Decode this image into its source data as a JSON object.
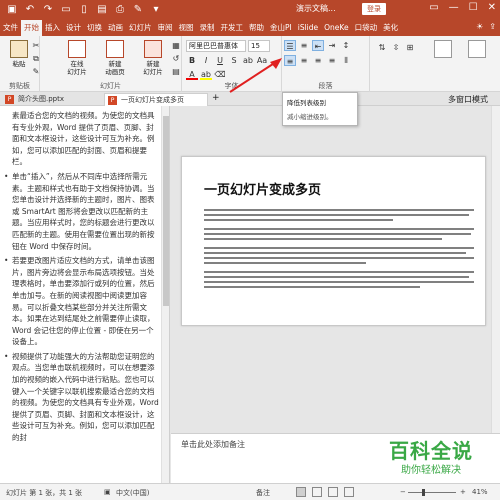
{
  "titlebar": {
    "title": "演示文稿...",
    "login": "登录",
    "bg": "#b7472a"
  },
  "tabs": [
    "文件",
    "开始",
    "插入",
    "设计",
    "切换",
    "动画",
    "幻灯片",
    "审阅",
    "视图",
    "录制",
    "开发工",
    "帮助",
    "金山PI",
    "iSlide",
    "OneKe",
    "口袋动",
    "美化"
  ],
  "tab_active_index": 1,
  "tabs_right": {
    "search_icon": "lightbulb-icon",
    "share_icon": "share-icon"
  },
  "ribbon": {
    "clipboard": {
      "label": "剪贴板",
      "paste": "粘贴"
    },
    "slides_group": {
      "label": "幻灯片",
      "new_slide": "新建\n幻灯片",
      "reuse": "在线\n幻灯片",
      "online": "新建\n动画页"
    },
    "font": {
      "label": "字体",
      "name": "阿里巴巴普惠体",
      "size": "15"
    },
    "paragraph": {
      "label": "段落"
    }
  },
  "tooltip": {
    "title": "降低列表级别",
    "desc": "减小缩进级别。"
  },
  "doctabs": [
    {
      "label": "简介头图.pptx",
      "active": false
    },
    {
      "label": "一页幻灯片变成多页",
      "active": true
    }
  ],
  "doctabs_right": "多窗口模式",
  "outline": [
    {
      "bullet": false,
      "text": "素最适合您的文档的视频。为使您的文档具有专业外观，Word 提供了页眉、页脚、封面和文本框设计，这些设计可互为补充。例如，您可以添加匹配的封面、页眉和提要栏。"
    },
    {
      "bullet": true,
      "text": "单击“插入”，然后从不同库中选择所需元素。主题和样式也有助于文档保持协调。当您单击设计并选择新的主题时，图片、图表或 SmartArt 图形将会更改以匹配新的主题。当应用样式时，您的标题会进行更改以匹配新的主题。使用在需要位置出现的新按钮在 Word 中保存时间。"
    },
    {
      "bullet": true,
      "text": "若要更改图片适应文档的方式，请单击该图片，图片旁边将会显示布局选项按钮。当处理表格时，单击要添加行或列的位置，然后单击加号。在新的阅读视图中阅读更加容易。可以折叠文档某些部分并关注所需文本。如果在达到结尾处之前需要停止读取，Word 会记住您的停止位置 - 即使在另一个设备上。"
    },
    {
      "bullet": true,
      "text": "视频提供了功能强大的方法帮助您证明您的观点。当您单击联机视频时，可以在想要添加的视频的嵌入代码中进行粘贴。您也可以键入一个关键字以联机搜索最适合您的文档的视频。为使您的文档具有专业外观，Word 提供了页眉、页脚、封面和文本框设计，这些设计可互为补充。例如，您可以添加匹配的封"
    }
  ],
  "slide": {
    "title": "一页幻灯片变成多页"
  },
  "notes_placeholder": "单击此处添加备注",
  "watermark": {
    "logo": "百科全说",
    "sub": "助你轻松解决"
  },
  "statusbar": {
    "slide_info": "幻灯片 第 1 张，共 1 张",
    "language": "中文(中国)",
    "notes": "备注",
    "zoom": "41%"
  }
}
